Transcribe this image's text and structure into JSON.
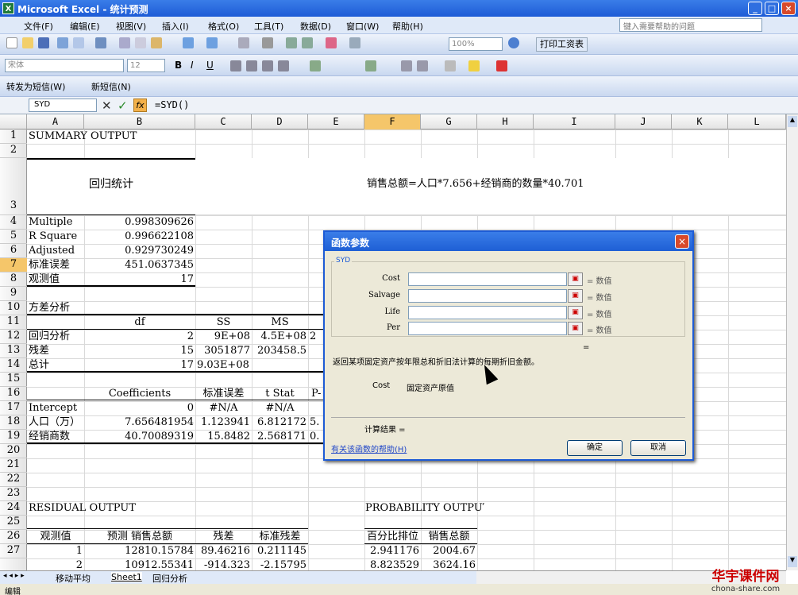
{
  "window": {
    "title": "Microsoft Excel - 统计预测",
    "app_icon": "excel-icon"
  },
  "menu": [
    "文件(F)",
    "编辑(E)",
    "视图(V)",
    "插入(I)",
    "格式(O)",
    "工具(T)",
    "数据(D)",
    "窗口(W)",
    "帮助(H)"
  ],
  "help_search": {
    "placeholder": "键入需要帮助的问题"
  },
  "toolbar": {
    "zoom": "100%",
    "print_sheet": "打印工资表",
    "font": "宋体",
    "font_size": "12",
    "convert_sms": "转发为短信(W)",
    "new_sms": "新短信(N)"
  },
  "formula_bar": {
    "name_box": "SYD",
    "formula": "=SYD()",
    "fx": "fx"
  },
  "columns": [
    "A",
    "B",
    "C",
    "D",
    "E",
    "F",
    "G",
    "H",
    "I",
    "J",
    "K",
    "L"
  ],
  "rows": [
    "1",
    "2",
    "3",
    "4",
    "5",
    "6",
    "7",
    "8",
    "9",
    "10",
    "11",
    "12",
    "13",
    "14",
    "15",
    "16",
    "17",
    "18",
    "19",
    "20",
    "21",
    "22",
    "23",
    "24",
    "25",
    "26",
    "27"
  ],
  "cells": {
    "a1": "SUMMARY OUTPUT",
    "a3_b3": "回归统计",
    "f3": "销售总额=人口*7.656+经销商的数量*40.701",
    "a4": "Multiple",
    "b4": "0.998309626",
    "a5": "R Square",
    "b5": "0.996622108",
    "a6": "Adjusted",
    "b6": "0.929730249",
    "a7": "标准误差",
    "b7": "451.0637345",
    "a8": "观测值",
    "b8": "17",
    "a10": "方差分析",
    "b11": "df",
    "c11": "SS",
    "d11": "MS",
    "a12": "回归分析",
    "b12": "2",
    "c12": "9E+08",
    "d12": "4.5E+08",
    "e12": "2",
    "a13": "残差",
    "b13": "15",
    "c13": "3051877",
    "d13": "203458.5",
    "a14": "总计",
    "b14": "17",
    "c14": "9.03E+08",
    "b16": "Coefficients",
    "c16": "标准误差",
    "d16": "t Stat",
    "e16": "P-",
    "a17": "Intercept",
    "b17": "0",
    "c17": "#N/A",
    "d17": "#N/A",
    "a18": "人口（万）",
    "b18": "7.656481954",
    "c18": "1.123941",
    "d18": "6.812172",
    "e18": "5.",
    "a19": "经销商数",
    "b19": "40.70089319",
    "c19": "15.8482",
    "d19": "2.568171",
    "e19": "0.",
    "a23": "RESIDUAL OUTPUT",
    "f23": "PROBABILITY OUTPUT",
    "a25": "观测值",
    "b25": "预测 销售总额",
    "c25": "残差",
    "d25": "标准残差",
    "f25": "百分比排位",
    "g25": "销售总额",
    "a26": "1",
    "b26": "12810.15784",
    "c26": "89.46216",
    "d26": "0.211145",
    "f26": "2.941176",
    "g26": "2004.67",
    "a27": "2",
    "b27": "10912.55341",
    "c27": "-914.323",
    "d27": "-2.15795",
    "f27": "8.823529",
    "g27": "3624.16"
  },
  "dialog": {
    "title": "函数参数",
    "group": "SYD",
    "params": [
      "Cost",
      "Salvage",
      "Life",
      "Per"
    ],
    "param_hint": "= 数值",
    "eq": "=",
    "description": "返回某项固定资产按年限总和折旧法计算的每期折旧金额。",
    "arg_name": "Cost",
    "arg_desc": "固定资产原值",
    "result": "计算结果 =",
    "help_link": "有关该函数的帮助(H)",
    "ok": "确定",
    "cancel": "取消"
  },
  "sheet_tabs": [
    "移动平均",
    "Sheet1",
    "回归分析"
  ],
  "status": "编辑",
  "watermark": {
    "line1": "华宇课件网",
    "line2": "chona-share.com"
  }
}
